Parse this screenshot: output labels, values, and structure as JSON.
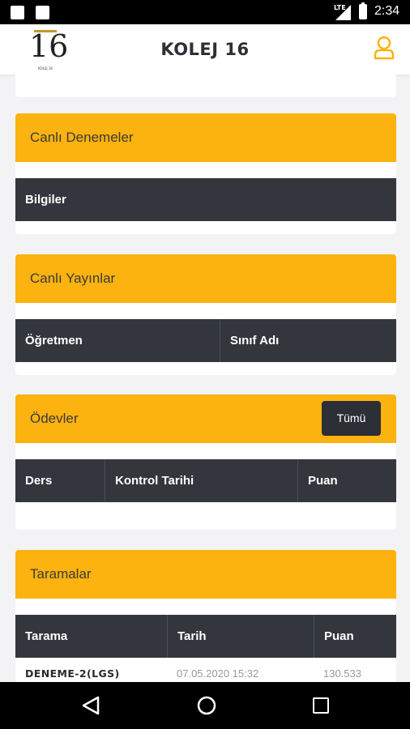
{
  "status_bar": {
    "network": "LTE",
    "time": "2:34"
  },
  "app_bar": {
    "title": "KOLEJ 16",
    "logo_text": "16",
    "logo_subtitle": "KOLEJ 16",
    "user_icon": "user-icon"
  },
  "sections": {
    "canli_denemeler": {
      "title": "Canlı Denemeler",
      "columns": [
        "Bilgiler"
      ]
    },
    "canli_yayinlar": {
      "title": "Canlı Yayınlar",
      "columns": [
        "Öğretmen",
        "Sınıf Adı"
      ]
    },
    "odevler": {
      "title": "Ödevler",
      "button": "Tümü",
      "columns": [
        "Ders",
        "Kontrol Tarihi",
        "Puan"
      ]
    },
    "taramalar": {
      "title": "Taramalar",
      "columns": [
        "Tarama",
        "Tarih",
        "Puan"
      ],
      "rows": [
        {
          "tarama": "DENEME-2(LGS)",
          "tarih": "07.05.2020 15:32",
          "puan": "130.533"
        }
      ]
    }
  },
  "nav_bar": {
    "back": "back-icon",
    "home": "home-icon",
    "recent": "recent-apps-icon"
  },
  "colors": {
    "accent": "#fcb20f",
    "header_dark": "#33363d",
    "button_dark": "#2c2f36"
  }
}
